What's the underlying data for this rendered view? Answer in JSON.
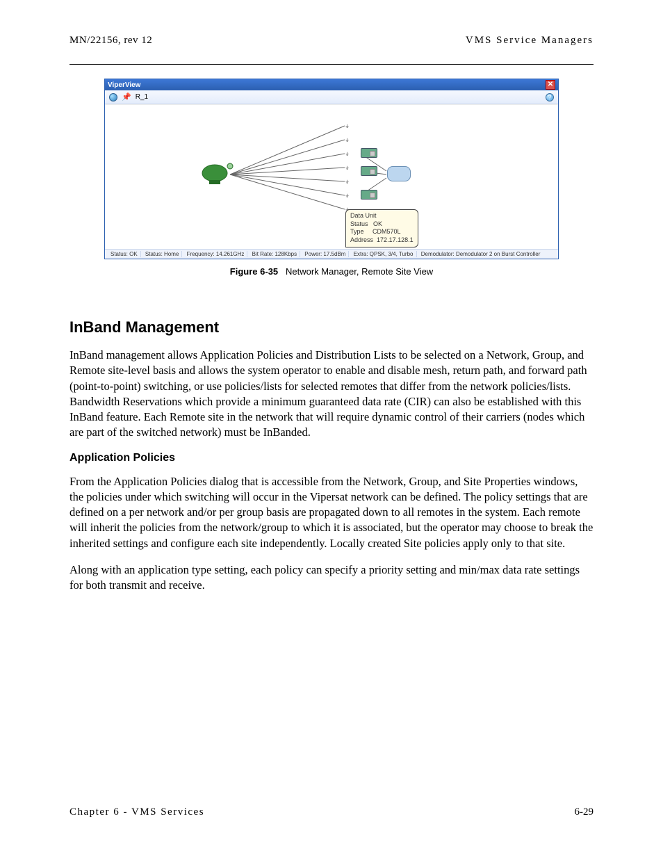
{
  "header": {
    "left": "MN/22156, rev 12",
    "right": "VMS Service Managers"
  },
  "window": {
    "title": "ViperView",
    "toolbar_label": "R_1",
    "tooltip": {
      "title": "Data Unit",
      "status_label": "Status",
      "status_value": "OK",
      "type_label": "Type",
      "type_value": "CDM570L",
      "addr_label": "Address",
      "addr_value": "172.17.128.1"
    },
    "status_segments": [
      "Status: OK",
      "Status: Home",
      "Frequency: 14.261GHz",
      "Bit Rate: 128Kbps",
      "Power: 17.5dBm",
      "Extra: QPSK, 3/4, Turbo",
      "Demodulator: Demodulator 2 on Burst Controller"
    ]
  },
  "figure": {
    "label": "Figure 6-35",
    "caption": "Network Manager, Remote Site View"
  },
  "section1": {
    "title": "InBand Management",
    "p1": "InBand management allows Application Policies and Distribution Lists to be selected on a Network, Group, and Remote site-level basis and allows the system operator to enable and disable mesh, return path, and forward path (point-to-point) switching, or use policies/lists for selected remotes that differ from the network policies/lists. Bandwidth Reservations which provide a minimum guaranteed data rate (CIR) can also be established with this InBand feature. Each Remote site in the network that will require dynamic control of their carriers (nodes which are part of the switched network) must be InBanded."
  },
  "section2": {
    "title": "Application Policies",
    "p1": "From the Application Policies dialog that is accessible from the Network, Group, and Site Properties windows, the policies under which switching will occur in the Vipersat network can be defined. The policy settings that are defined on a per network and/or per group basis are propagated down to all remotes in the system. Each remote will inherit the policies from the network/group to which it is associated, but the operator may choose to break the inherited settings and configure each site independently. Locally created Site policies apply only to that site.",
    "p2": "Along with an application type setting, each policy can specify a priority setting and min/max data rate settings for both transmit and receive."
  },
  "footer": {
    "left": "Chapter 6 - VMS Services",
    "right": "6-29"
  }
}
